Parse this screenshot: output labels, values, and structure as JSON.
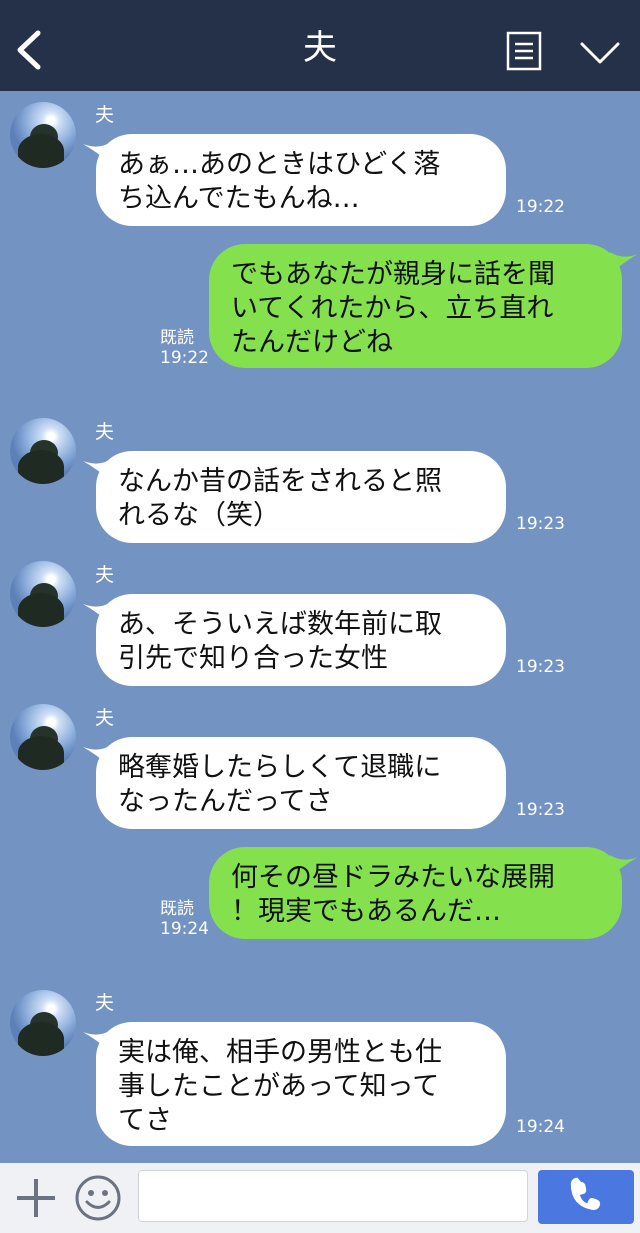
{
  "header": {
    "title": "夫"
  },
  "messages": [
    {
      "type": "in",
      "sender": "夫",
      "lines": [
        "あぁ…あのときはひどく落",
        "ち込んでたもんね…"
      ],
      "time": "19:22"
    },
    {
      "type": "out",
      "read": "既読",
      "lines": [
        "でもあなたが親身に話を聞",
        "いてくれたから、立ち直れ",
        "たんだけどね"
      ],
      "time": "19:22"
    },
    {
      "type": "in",
      "sender": "夫",
      "lines": [
        "なんか昔の話をされると照",
        "れるな（笑）"
      ],
      "time": "19:23"
    },
    {
      "type": "in",
      "sender": "夫",
      "lines": [
        "あ、そういえば数年前に取",
        "引先で知り合った女性"
      ],
      "time": "19:23"
    },
    {
      "type": "in",
      "sender": "夫",
      "lines": [
        "略奪婚したらしくて退職に",
        "なったんだってさ"
      ],
      "time": "19:23"
    },
    {
      "type": "out",
      "read": "既読",
      "lines": [
        "何その昼ドラみたいな展開",
        "！現実でもあるんだ…"
      ],
      "time": "19:24"
    },
    {
      "type": "in",
      "sender": "夫",
      "lines": [
        "実は俺、相手の男性とも仕",
        "事したことがあって知って",
        "てさ"
      ],
      "time": "19:24"
    }
  ],
  "footer": {
    "input_value": "",
    "input_placeholder": ""
  },
  "colors": {
    "background": "#7394c3",
    "header": "#243149",
    "incoming_bubble": "#ffffff",
    "outgoing_bubble": "#84e04c",
    "call_button": "#4a78e0"
  }
}
